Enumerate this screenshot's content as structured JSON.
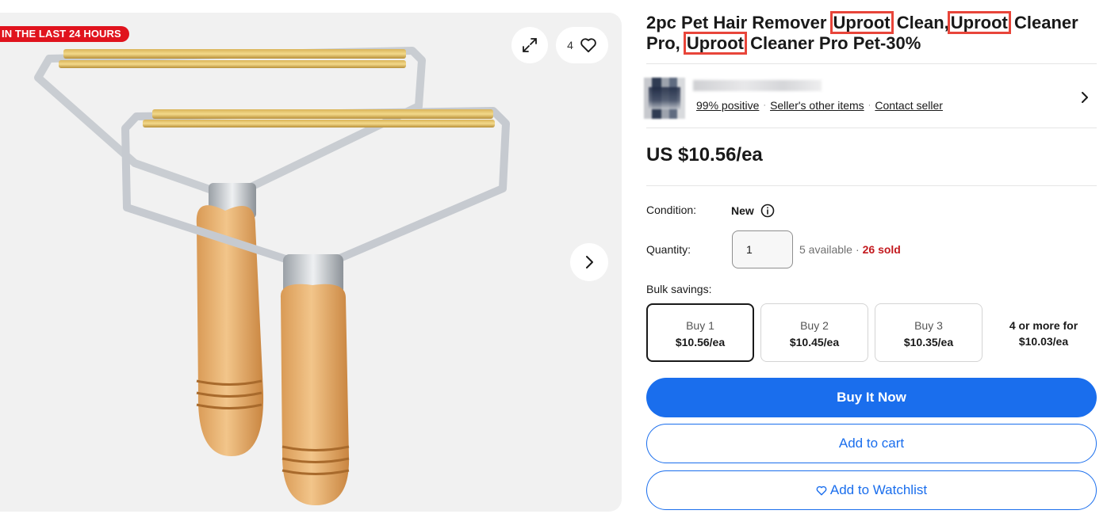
{
  "gallery": {
    "ribbon": "IN THE LAST 24 HOURS",
    "favorite_count": "4"
  },
  "listing": {
    "title_parts": {
      "p1": "2pc Pet Hair Remover ",
      "h1": "Uproot",
      "p2": " Clean,",
      "h2": "Uproot",
      "p3": " Cleaner Pro, ",
      "h3": "Uproot",
      "p4": " Cleaner Pro Pet-30%"
    },
    "price": "US $10.56/ea"
  },
  "seller": {
    "feedback": "99% positive",
    "other_items": "Seller's other items",
    "contact": "Contact seller",
    "separator": "·"
  },
  "condition": {
    "label": "Condition:",
    "value": "New"
  },
  "quantity": {
    "label": "Quantity:",
    "value": "1",
    "available": "5 available",
    "separator": "·",
    "sold": "26 sold"
  },
  "bulk": {
    "label": "Bulk savings:",
    "options": [
      {
        "qty": "Buy 1",
        "price": "$10.56/ea"
      },
      {
        "qty": "Buy 2",
        "price": "$10.45/ea"
      },
      {
        "qty": "Buy 3",
        "price": "$10.35/ea"
      }
    ],
    "more_line1": "4 or more for",
    "more_line2": "$10.03/ea"
  },
  "actions": {
    "buy_now": "Buy It Now",
    "add_to_cart": "Add to cart",
    "add_to_watchlist": "Add to Watchlist"
  },
  "colors": {
    "primary": "#1a6eed",
    "ribbon": "#e0131d",
    "sold": "#c31a1f",
    "highlight_box": "#e8453a"
  }
}
